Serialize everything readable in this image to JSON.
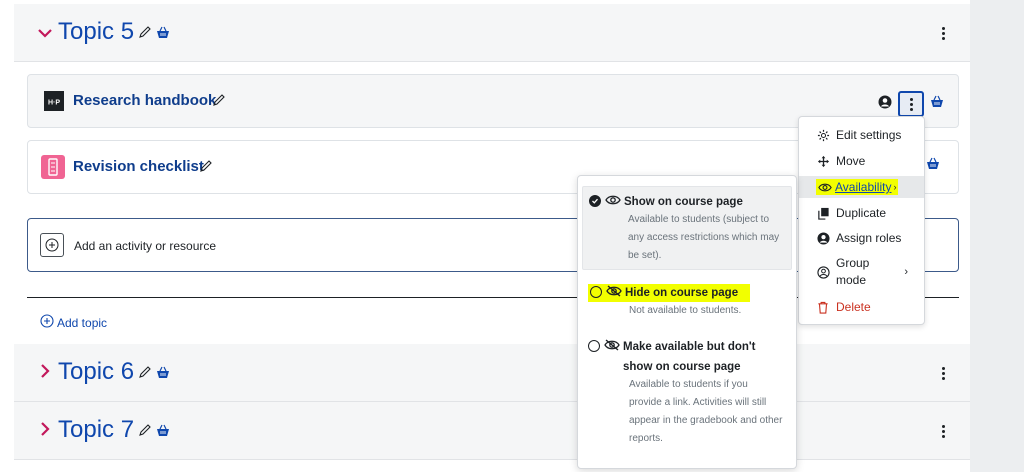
{
  "topics": [
    {
      "name": "Topic 5",
      "expanded": true
    },
    {
      "name": "Topic 6",
      "expanded": false
    },
    {
      "name": "Topic 7",
      "expanded": false
    }
  ],
  "activities": [
    {
      "name": "Research handbook",
      "icon": "h5p-icon"
    },
    {
      "name": "Revision checklist",
      "icon": "checklist-icon"
    }
  ],
  "add_activity": {
    "label": "Add an activity or resource"
  },
  "add_topic": {
    "label": "Add topic"
  },
  "menu": {
    "items": [
      {
        "label": "Edit settings",
        "icon": "gear-icon"
      },
      {
        "label": "Move",
        "icon": "move-arrows-icon"
      },
      {
        "label": "Availability",
        "icon": "eye-icon"
      },
      {
        "label": "Duplicate",
        "icon": "copy-icon"
      },
      {
        "label": "Assign roles",
        "icon": "user-icon"
      },
      {
        "label_line1": "Group",
        "label_line2": "mode",
        "icon": "group-icon"
      },
      {
        "label": "Delete",
        "icon": "trash-icon"
      }
    ]
  },
  "availability": {
    "options": [
      {
        "title": "Show on course page",
        "desc": [
          "Available to students (subject to",
          "any access restrictions which may",
          "be set)."
        ],
        "checked": true
      },
      {
        "title": "Hide on course page",
        "desc": [
          "Not available to students."
        ],
        "checked": false
      },
      {
        "title_line1": "Make available but don't",
        "title_line2": "show on course page",
        "desc": [
          "Available to students if you",
          "provide a link. Activities will still",
          "appear in the gradebook and other",
          "reports."
        ],
        "checked": false
      }
    ]
  },
  "colors": {
    "accent": "#0f47ad",
    "chevron": "#c2185b",
    "highlight": "#f2ff00",
    "danger": "#ca3120"
  }
}
